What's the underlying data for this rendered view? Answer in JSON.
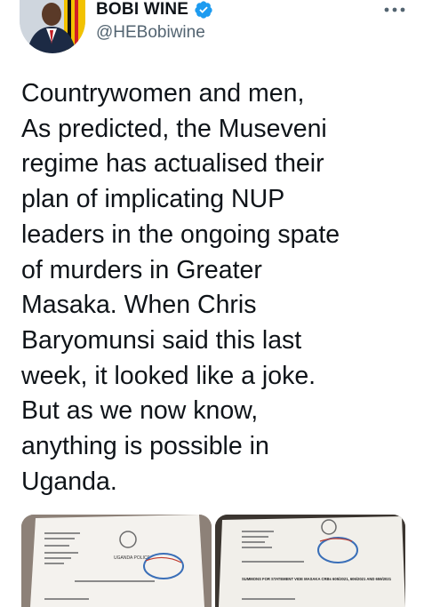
{
  "author": {
    "display_name": "BOBI WINE",
    "handle": "@HEBobiwine",
    "avatar_icon": "profile-photo",
    "verified_icon": "verified-badge-icon",
    "verified_color": "#1d9bf0"
  },
  "more_icon": "more-options-icon",
  "tweet_text": "Countrywomen and men,\nAs predicted, the Museveni\nregime has actualised their\nplan of implicating NUP\nleaders in the ongoing spate\nof murders in Greater\nMasaka. When Chris\nBaryomunsi said this last\nweek, it looked like a joke.\nBut as we now know,\nanything is possible in\nUganda.",
  "media": [
    {
      "kind": "photo",
      "description_icon": "document-photo",
      "visible_text": "UGANDA POLICE"
    },
    {
      "kind": "photo",
      "description_icon": "document-photo",
      "visible_text": "SUMMONS FOR STATEMENT VIDE MASAKA CRBs 605/2021, 606/2021 AND 659/2021"
    }
  ]
}
